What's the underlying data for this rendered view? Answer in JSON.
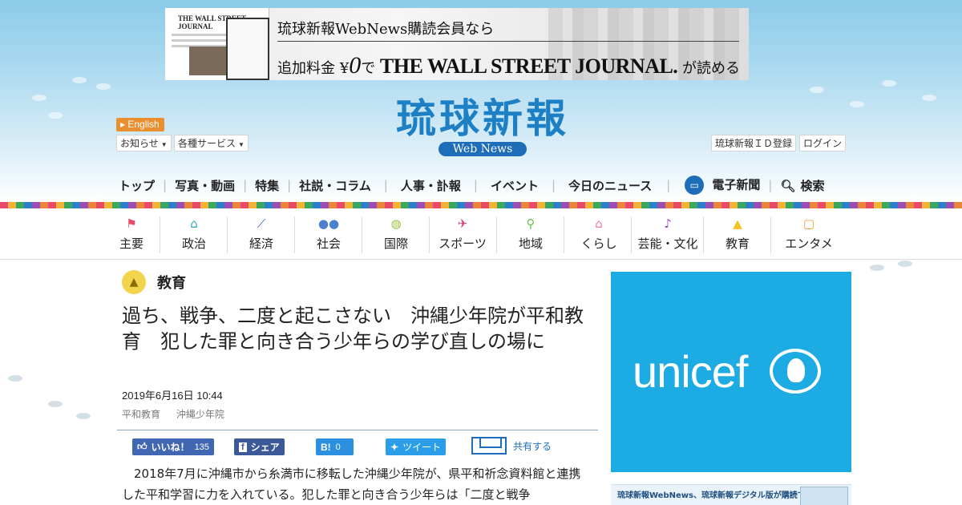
{
  "banner": {
    "line1": "琉球新報WebNews購読会員なら",
    "line2_prefix": "追加料金",
    "line2_yen": "¥",
    "line2_zero": "0",
    "line2_de": "で",
    "line2_wsj": "THE WALL STREET JOURNAL.",
    "line2_suffix": "が読める",
    "thumb_masthead": "THE WALL STREET JOURNAL"
  },
  "logo": {
    "kanji": "琉球新報",
    "sub": "Web News"
  },
  "header": {
    "english": "English",
    "notices": "お知らせ",
    "services": "各種サービス",
    "id_register": "琉球新報ＩＤ登録",
    "login": "ログイン"
  },
  "nav": {
    "top": "トップ",
    "photo_video": "写真・動画",
    "special": "特集",
    "editorial": "社説・コラム",
    "personnel": "人事・訃報",
    "event": "イベント",
    "today": "今日のニュース",
    "epaper": "電子新聞",
    "search": "検索"
  },
  "categories": [
    {
      "label": "主要",
      "icon": "flag-icon",
      "color": "#e84b6a"
    },
    {
      "label": "政治",
      "icon": "government-building-icon",
      "color": "#2fa9b8"
    },
    {
      "label": "経済",
      "icon": "line-chart-icon",
      "color": "#3b5fb0"
    },
    {
      "label": "社会",
      "icon": "people-icon",
      "color": "#4b7fd0"
    },
    {
      "label": "国際",
      "icon": "globe-icon",
      "color": "#9ac23b"
    },
    {
      "label": "スポーツ",
      "icon": "runner-icon",
      "color": "#e0407a"
    },
    {
      "label": "地域",
      "icon": "map-pin-icon",
      "color": "#6cbf4a"
    },
    {
      "label": "くらし",
      "icon": "house-icon",
      "color": "#f07a9a"
    },
    {
      "label": "芸能・文化",
      "icon": "music-icon",
      "color": "#9b4fb4"
    },
    {
      "label": "教育",
      "icon": "mortarboard-icon",
      "color": "#f2c21f"
    },
    {
      "label": "エンタメ",
      "icon": "tv-icon",
      "color": "#f29a2e"
    }
  ],
  "article": {
    "section": "教育",
    "headline": "過ち、戦争、二度と起こさない　沖縄少年院が平和教育　犯した罪と向き合う少年らの学び直しの場に",
    "date": "2019年6月16日 10:44",
    "tags": [
      "平和教育",
      "沖縄少年院"
    ],
    "body": "2018年7月に沖縄市から糸満市に移転した沖縄少年院が、県平和祈念資料館と連携した平和学習に力を入れている。犯した罪と向き合う少年らは「二度と戦争"
  },
  "share": {
    "like": "いいね！",
    "like_count": "135",
    "fb_share": "シェア",
    "hatena": "B!",
    "hatena_count": "0",
    "tweet": "ツイート",
    "share_all": "共有する",
    "colors": {
      "like": "#4267b2",
      "fb": "#3b5998",
      "hatena": "#2c8fe0",
      "twitter": "#2a9ee8"
    }
  },
  "sidebar": {
    "ad1_brand": "unicef",
    "ad2_text": "琉球新報WebNews、琉球新報デジタル版が購読できる"
  }
}
